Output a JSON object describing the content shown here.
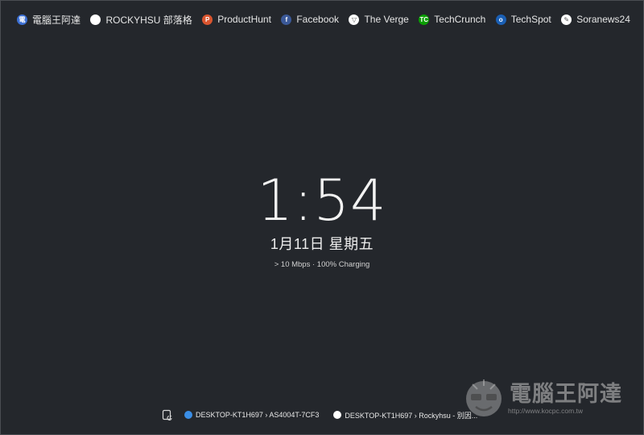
{
  "bookmarks": [
    {
      "label": "電腦王阿達",
      "icon": "computer-king-icon",
      "color": "#3b6fd4",
      "glyph": "電"
    },
    {
      "label": "ROCKYHSU 部落格",
      "icon": "rockyhsu-icon",
      "color": "#ffffff",
      "glyph": ""
    },
    {
      "label": "ProductHunt",
      "icon": "producthunt-icon",
      "color": "#da552f",
      "glyph": "P"
    },
    {
      "label": "Facebook",
      "icon": "facebook-icon",
      "color": "#3b5998",
      "glyph": "f"
    },
    {
      "label": "The Verge",
      "icon": "verge-icon",
      "color": "#ffffff",
      "glyph": "▽"
    },
    {
      "label": "TechCrunch",
      "icon": "techcrunch-icon",
      "color": "#0a9e01",
      "glyph": "TC"
    },
    {
      "label": "TechSpot",
      "icon": "techspot-icon",
      "color": "#1a5fb4",
      "glyph": "o"
    },
    {
      "label": "Soranews24",
      "icon": "soranews24-icon",
      "color": "#ffffff",
      "glyph": "✎"
    }
  ],
  "clock": {
    "time": "1:54",
    "date": "1月11日 星期五",
    "status": "> 10 Mbps · 100% Charging"
  },
  "devices": [
    {
      "label": "DESKTOP-KT1H697 › AS4004T-7CF3",
      "icon": "ie-browser-icon",
      "color": "#3a8ee6"
    },
    {
      "label": "DESKTOP-KT1H697 › Rockyhsu - 別因...",
      "icon": "rockyhsu-tab-icon",
      "color": "#ffffff"
    }
  ],
  "watermark": {
    "text": "電腦王阿達",
    "url": "http://www.kocpc.com.tw"
  }
}
